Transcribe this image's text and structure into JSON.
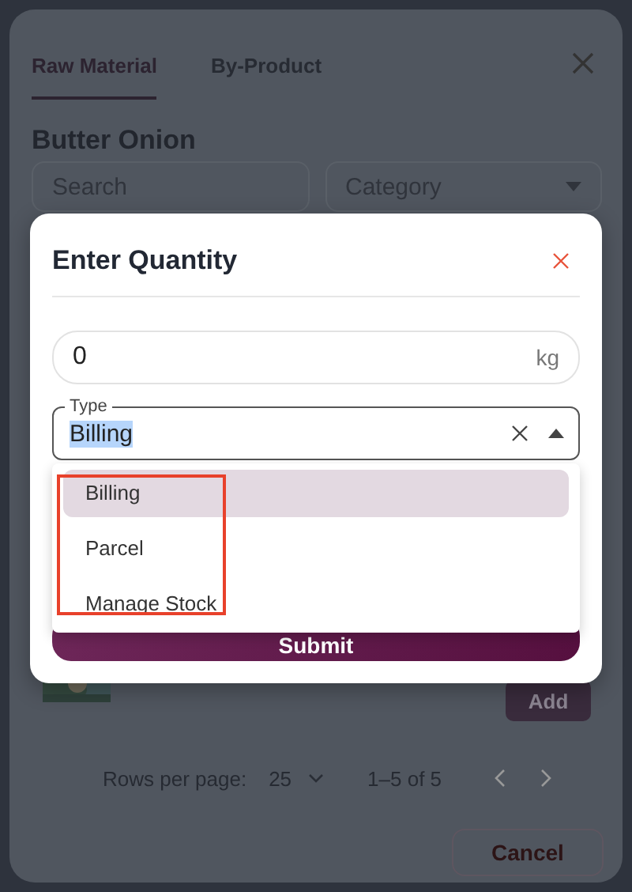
{
  "tabs": [
    {
      "label": "Raw Material",
      "selected": true
    },
    {
      "label": "By-Product",
      "selected": false
    }
  ],
  "title": "Butter Onion",
  "filters": {
    "search": {
      "placeholder": "Search"
    },
    "category": {
      "placeholder": "Category"
    }
  },
  "row": {
    "action": "Add"
  },
  "pagination": {
    "label": "Rows per page:",
    "rows": "25",
    "range": "1–5 of 5"
  },
  "cancel": "Cancel",
  "dialog": {
    "title": "Enter Quantity",
    "quantity": {
      "value": "0",
      "unit": "kg"
    },
    "type": {
      "label": "Type",
      "value": "Billing",
      "expanded": true
    },
    "options": [
      {
        "label": "Billing",
        "selected": true
      },
      {
        "label": "Parcel",
        "selected": false
      },
      {
        "label": "Manage Stock",
        "selected": false
      }
    ],
    "annotation": true,
    "submit": "Submit"
  }
}
